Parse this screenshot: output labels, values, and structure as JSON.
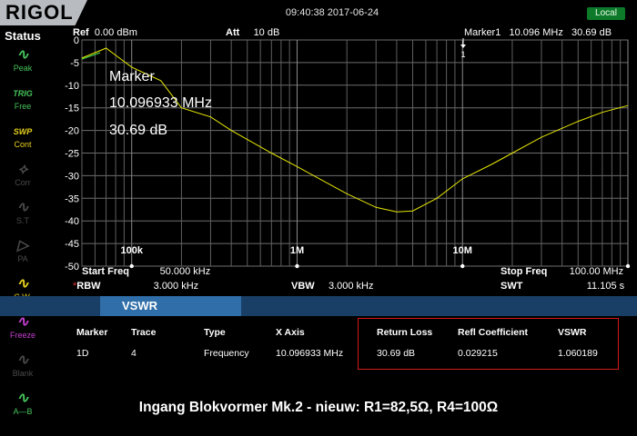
{
  "header": {
    "logo": "RIGOL",
    "datetime": "09:40:38 2017-06-24",
    "local_label": "Local"
  },
  "sidebar": {
    "title": "Status",
    "items": [
      {
        "label": "Peak",
        "icon": "wave-icon",
        "glyph": "∿",
        "color": "#46c35a"
      },
      {
        "label": "Free",
        "icon": "trig-icon",
        "glyph": "TRIG",
        "color": "#46c35a"
      },
      {
        "label": "Cont",
        "icon": "swp-icon",
        "glyph": "SWP",
        "color": "#e8d21c"
      },
      {
        "label": "Corr",
        "icon": "corr-icon",
        "glyph": "⟡",
        "color": "#4a4a4a"
      },
      {
        "label": "S.T",
        "icon": "st-icon",
        "glyph": "∿",
        "color": "#4a4a4a"
      },
      {
        "label": "PA",
        "icon": "pa-icon",
        "glyph": "▷",
        "color": "#4a4a4a"
      },
      {
        "label": "C.W.",
        "icon": "cw-icon",
        "glyph": "∿",
        "color": "#e8d21c"
      },
      {
        "label": "Freeze",
        "icon": "freeze-icon",
        "glyph": "∿",
        "color": "#c43fd1"
      },
      {
        "label": "Blank",
        "icon": "blank-icon",
        "glyph": "∿",
        "color": "#4a4a4a"
      },
      {
        "label": "A—B",
        "icon": "a-minus-b-icon",
        "glyph": "∿",
        "color": "#46c35a"
      }
    ]
  },
  "screen": {
    "ref_label": "Ref",
    "ref_value": "0.00 dBm",
    "att_label": "Att",
    "att_value": "10 dB",
    "marker_label": "Marker1",
    "marker_freq": "10.096 MHz",
    "marker_level": "30.69 dB",
    "marker_number": "1",
    "overlay_title": "Marker",
    "overlay_freq": "10.096933 MHz",
    "overlay_level": "30.69 dB",
    "y_ticks": [
      "0",
      "-5",
      "-10",
      "-15",
      "-20",
      "-25",
      "-30",
      "-35",
      "-40",
      "-45",
      "-50"
    ],
    "x_decade_labels": [
      "100k",
      "1M",
      "10M"
    ]
  },
  "settings": {
    "start_label": "Start Freq",
    "start_value": "50.000 kHz",
    "stop_label": "Stop Freq",
    "stop_value": "100.00 MHz",
    "rbw_star": "*",
    "rbw_label": "RBW",
    "rbw_value": "3.000 kHz",
    "vbw_label": "VBW",
    "vbw_value": "3.000 kHz",
    "swt_label": "SWT",
    "swt_value": "11.105 s"
  },
  "vswr": {
    "tab_label": "VSWR",
    "headers": [
      "Marker",
      "Trace",
      "Type",
      "X Axis",
      "Return Loss",
      "Refl Coefficient",
      "VSWR"
    ],
    "row": [
      "1D",
      "4",
      "Frequency",
      "10.096933 MHz",
      "30.69 dB",
      "0.029215",
      "1.060189"
    ]
  },
  "caption": "Ingang Blokvormer Mk.2 - nieuw: R1=82,5Ω, R4=100Ω",
  "chart_data": {
    "type": "line",
    "xlabel": "",
    "ylabel": "",
    "x_scale": "log",
    "xlim": [
      50000,
      100000000
    ],
    "ylim": [
      -50,
      0
    ],
    "grid": true,
    "series": [
      {
        "color": "#e6e600",
        "x": [
          50000,
          70000,
          100000,
          150000,
          200000,
          300000,
          400000,
          500000,
          700000,
          1000000,
          1500000,
          2000000,
          3000000,
          4000000,
          5000000,
          7000000,
          10000000,
          15000000,
          20000000,
          30000000,
          50000000,
          70000000,
          100000000
        ],
        "y": [
          -4,
          -1.8,
          -6,
          -9,
          -15,
          -17,
          -20,
          -22,
          -25,
          -28,
          -31.5,
          -34,
          -37,
          -38,
          -37.8,
          -35,
          -30.7,
          -27.5,
          -25,
          -21.5,
          -18,
          -16,
          -14.5
        ]
      }
    ]
  }
}
